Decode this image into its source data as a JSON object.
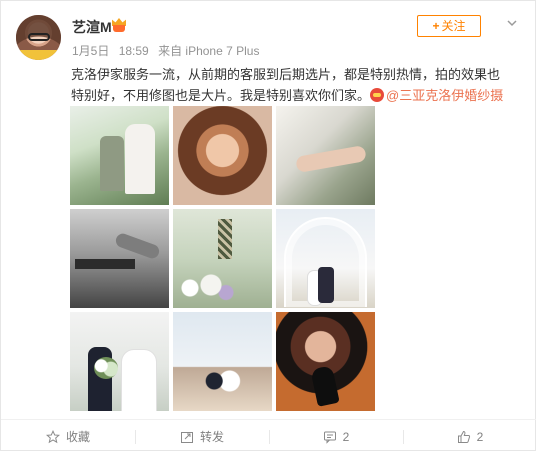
{
  "post": {
    "user_name": "艺渲M",
    "meta": {
      "date": "1月5日",
      "time": "18:59",
      "source": "来自 iPhone 7 Plus"
    },
    "follow_label": "关注",
    "text_main": "克洛伊家服务一流，从前期的客服到后期选片，都是特别热情，拍的效果也特别好，不用修图也是大片。我是特别喜欢你们家。",
    "mention": "@三亚克洛伊婚纱摄影"
  },
  "images": [
    {
      "name": "photo-1"
    },
    {
      "name": "photo-2"
    },
    {
      "name": "photo-3"
    },
    {
      "name": "photo-4"
    },
    {
      "name": "photo-5"
    },
    {
      "name": "photo-6"
    },
    {
      "name": "photo-7"
    },
    {
      "name": "photo-8"
    },
    {
      "name": "photo-9"
    }
  ],
  "actions": {
    "favorite_label": "收藏",
    "repost_label": "转发",
    "comment_count": "2",
    "like_count": "2"
  },
  "colors": {
    "follow_accent": "#ff8200",
    "mention": "#eb7350",
    "meta_gray": "#939393"
  },
  "icons": {
    "badge": "vip-badge-icon",
    "dropdown": "chevron-down-icon",
    "favorite": "star-icon",
    "repost": "repost-icon",
    "comment": "comment-icon",
    "like": "thumbs-up-icon"
  }
}
